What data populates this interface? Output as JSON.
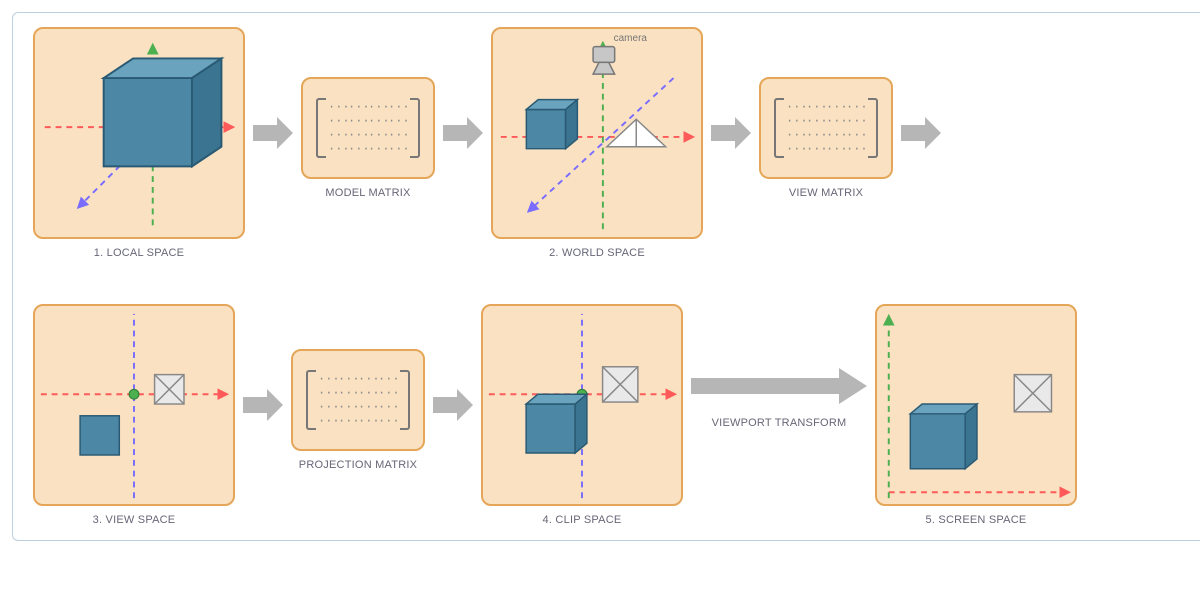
{
  "pipeline": {
    "stages": {
      "s1": "1. LOCAL SPACE",
      "s2": "2. WORLD SPACE",
      "s3": "3. VIEW SPACE",
      "s4": "4. CLIP SPACE",
      "s5": "5. SCREEN SPACE"
    },
    "transforms": {
      "t1": "MODEL MATRIX",
      "t2": "VIEW MATRIX",
      "t3": "PROJECTION MATRIX",
      "t4": "VIEWPORT TRANSFORM"
    },
    "matrix_cell": "···",
    "camera_label": "camera"
  },
  "colors": {
    "card_fill": "#f9e1c1",
    "card_border": "#e5a659",
    "arrow": "#b6b6b6",
    "cube_fill": "#4c87a5",
    "cube_stroke": "#2a5a73",
    "axis_x": "#ff5a5a",
    "axis_y": "#4caf50",
    "axis_z": "#7a6cff"
  }
}
